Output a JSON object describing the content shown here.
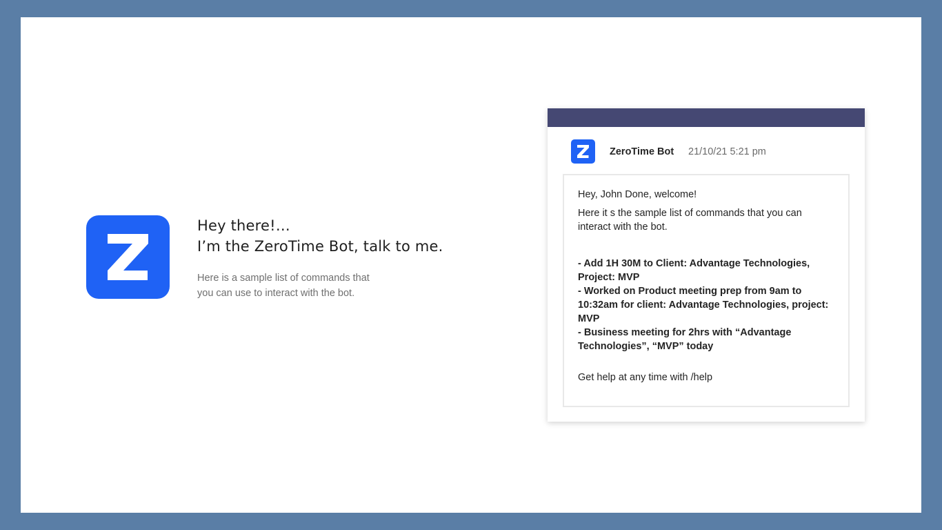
{
  "intro": {
    "title_line1": "Hey there!…",
    "title_line2": "I’m the ZeroTime Bot, talk to me.",
    "subtitle_line1": "Here is a sample list of commands that",
    "subtitle_line2": "you can use to interact with the bot.",
    "logo_icon": "zerotime-z-logo",
    "logo_letter": "Z"
  },
  "card": {
    "bot_name": "ZeroTime Bot",
    "timestamp": "21/10/21 5:21 pm",
    "avatar_icon": "zerotime-z-logo",
    "message": {
      "greeting": "Hey, John Done, welcome!",
      "intro": "Here it s the sample list of commands that you can interact with the bot.",
      "commands": [
        "-  Add 1H 30M to Client: Advantage Technologies, Project: MVP",
        "- Worked on Product meeting prep from 9am to 10:32am for client: Advantage Technologies, project: MVP",
        "- Business meeting for 2hrs with “Advantage Technologies”, “MVP” today"
      ],
      "help": "Get help at any time with /help"
    }
  },
  "colors": {
    "page_background": "#5a7ea6",
    "brand_blue": "#1f62f5",
    "card_topbar": "#454873",
    "text_dark": "#1e1e1e",
    "text_muted": "#6f6f6f"
  }
}
